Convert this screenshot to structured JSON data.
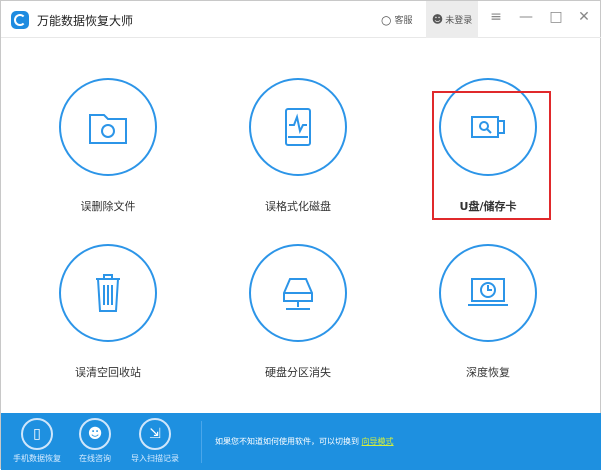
{
  "title": "万能数据恢复大师",
  "toolbar": {
    "service": "客服",
    "login": "未登录"
  },
  "tiles": [
    {
      "label": "误删除文件",
      "icon": "folder-recycle-icon"
    },
    {
      "label": "误格式化磁盘",
      "icon": "disk-pulse-icon"
    },
    {
      "label": "U盘/储存卡",
      "icon": "usb-drive-icon"
    },
    {
      "label": "误清空回收站",
      "icon": "trash-icon"
    },
    {
      "label": "硬盘分区消失",
      "icon": "network-drive-icon"
    },
    {
      "label": "深度恢复",
      "icon": "laptop-clock-icon"
    }
  ],
  "bottom": {
    "buttons": [
      {
        "label": "手机数据恢复"
      },
      {
        "label": "在线咨询"
      },
      {
        "label": "导入扫描记录"
      }
    ],
    "hint": "如果您不知道如何使用软件，可以切换到",
    "hint_link": "向导模式"
  },
  "colors": {
    "accent": "#1e90e0",
    "selection": "#e0292b"
  }
}
